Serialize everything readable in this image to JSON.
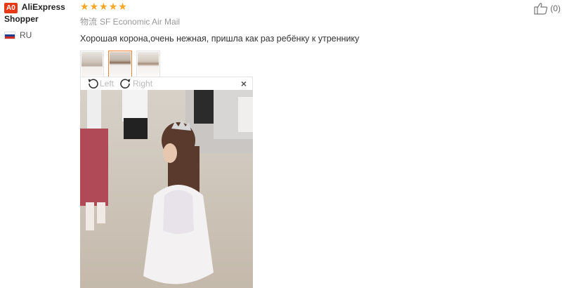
{
  "user": {
    "badge": "A0",
    "name_line1": "AliExpress",
    "name_line2": "Shopper",
    "country": "RU",
    "flag_colors": [
      "#ffffff",
      "#1c3f94",
      "#d52b1e"
    ]
  },
  "review": {
    "rating": 5,
    "stars": [
      "★",
      "★",
      "★",
      "★",
      "★"
    ],
    "shipping_label": "物流",
    "shipping_method": "SF Economic Air Mail",
    "text": "Хорошая корона,очень нежная, пришла как раз ребёнку к утреннику"
  },
  "thumbnails": [
    {
      "name": "photo-1",
      "active": false
    },
    {
      "name": "photo-2",
      "active": true
    },
    {
      "name": "photo-3",
      "active": false
    }
  ],
  "viewer": {
    "rotate_left_label": "Left",
    "rotate_right_label": "Right",
    "close_glyph": "×"
  },
  "like": {
    "count": "(0)"
  },
  "colors": {
    "accent": "#f0802b",
    "star": "#f5a623",
    "badge": "#e63a17"
  }
}
